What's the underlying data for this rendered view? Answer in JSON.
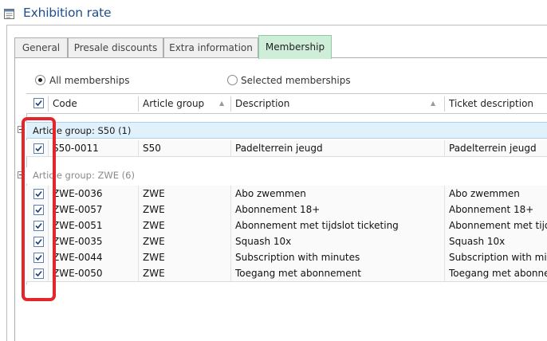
{
  "window": {
    "title": "Exhibition rate"
  },
  "tabs": [
    {
      "label": "General"
    },
    {
      "label": "Presale discounts"
    },
    {
      "label": "Extra information"
    },
    {
      "label": "Membership",
      "active": true
    }
  ],
  "filter": {
    "all_label": "All memberships",
    "selected_label": "Selected memberships",
    "selected": "all"
  },
  "grid": {
    "columns": {
      "code": "Code",
      "article_group": "Article group",
      "description": "Description",
      "ticket_description": "Ticket description"
    },
    "groups": [
      {
        "label": "Article group:  S50 (1)",
        "rows": [
          {
            "code": "S50-0011",
            "article_group": "S50",
            "description": "Padelterrein jeugd",
            "ticket_description": "Padelterrein jeugd",
            "checked": true
          }
        ]
      },
      {
        "label": "Article group:  ZWE (6)",
        "rows": [
          {
            "code": "ZWE-0036",
            "article_group": "ZWE",
            "description": "Abo zwemmen",
            "ticket_description": "Abo zwemmen",
            "checked": true
          },
          {
            "code": "ZWE-0057",
            "article_group": "ZWE",
            "description": "Abonnement 18+",
            "ticket_description": "Abonnement 18+",
            "checked": true
          },
          {
            "code": "ZWE-0051",
            "article_group": "ZWE",
            "description": "Abonnement met tijdslot ticketing",
            "ticket_description": "Abonnement met tijdslot",
            "checked": true
          },
          {
            "code": "ZWE-0035",
            "article_group": "ZWE",
            "description": "Squash 10x",
            "ticket_description": "Squash 10x",
            "checked": true
          },
          {
            "code": "ZWE-0044",
            "article_group": "ZWE",
            "description": "Subscription with minutes",
            "ticket_description": "Subscription with minut",
            "checked": true
          },
          {
            "code": "ZWE-0050",
            "article_group": "ZWE",
            "description": "Toegang met abonnement",
            "ticket_description": "Toegang met abonnem",
            "checked": true
          }
        ]
      }
    ]
  },
  "colors": {
    "title": "#1e4e8c",
    "active_tab": "#cfeeda",
    "group_highlight": "#e1f1fb",
    "annotation": "#e4262b"
  },
  "icons": {
    "title": "document-icon",
    "check": "checkmark-icon",
    "sort": "sort-up-icon",
    "group_toggle": "collapse-minus-icon"
  }
}
